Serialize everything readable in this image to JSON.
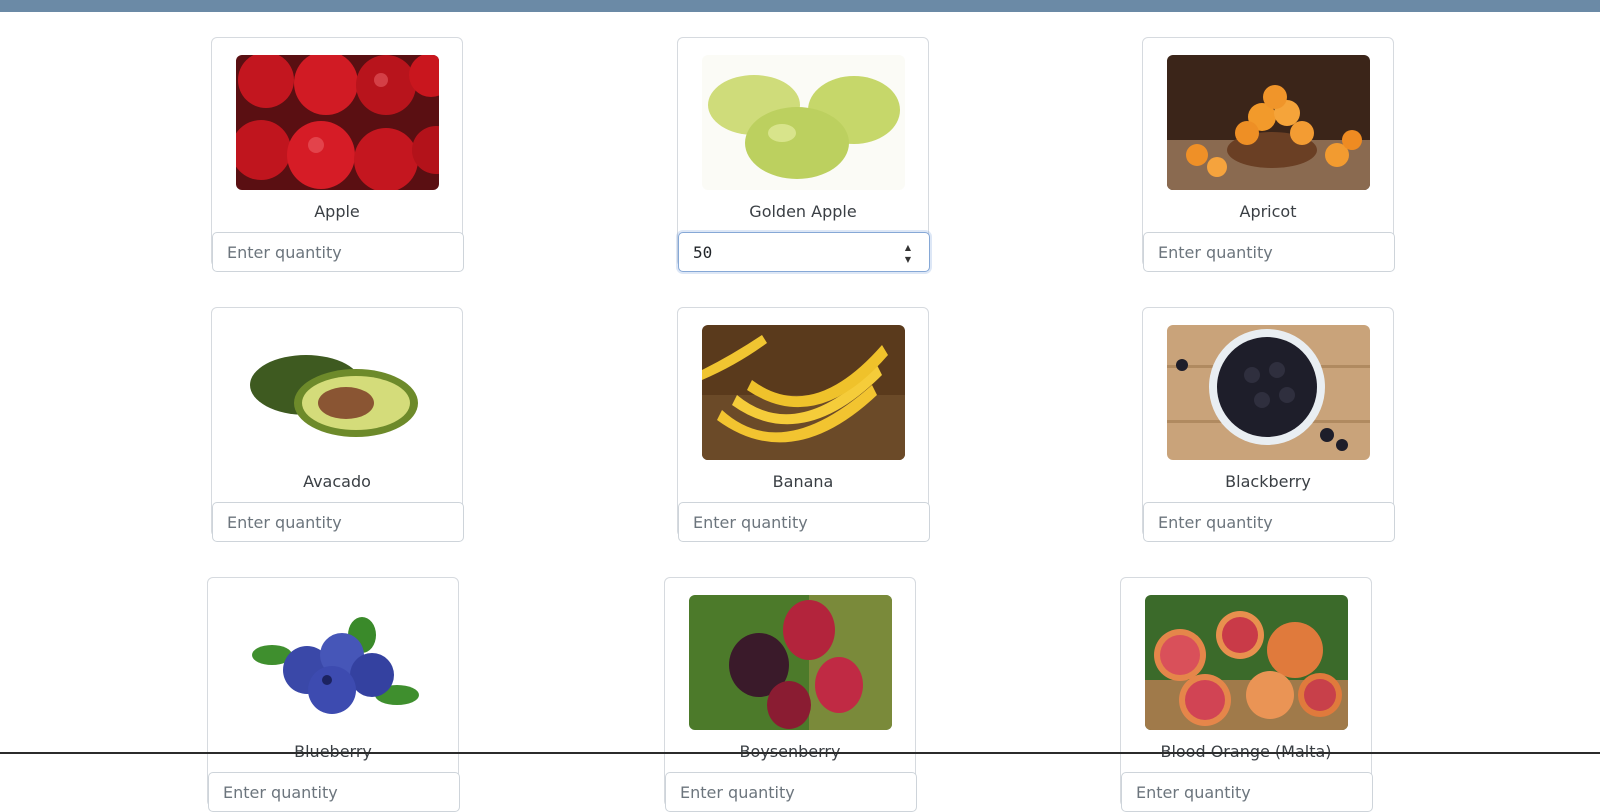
{
  "products": [
    {
      "name": "Apple",
      "qty": "",
      "placeholder": "Enter quantity"
    },
    {
      "name": "Golden Apple",
      "qty": "50",
      "placeholder": "Enter quantity"
    },
    {
      "name": "Apricot",
      "qty": "",
      "placeholder": "Enter quantity"
    },
    {
      "name": "Avacado",
      "qty": "",
      "placeholder": "Enter quantity"
    },
    {
      "name": "Banana",
      "qty": "",
      "placeholder": "Enter quantity"
    },
    {
      "name": "Blackberry",
      "qty": "",
      "placeholder": "Enter quantity"
    },
    {
      "name": "Blueberry",
      "qty": "",
      "placeholder": "Enter quantity"
    },
    {
      "name": "Boysenberry",
      "qty": "",
      "placeholder": "Enter quantity"
    },
    {
      "name": "Blood Orange (Malta)",
      "qty": "",
      "placeholder": "Enter quantity"
    }
  ],
  "colors": {
    "topbar": "#6b8aa6",
    "focus_border": "#86a8d6"
  }
}
